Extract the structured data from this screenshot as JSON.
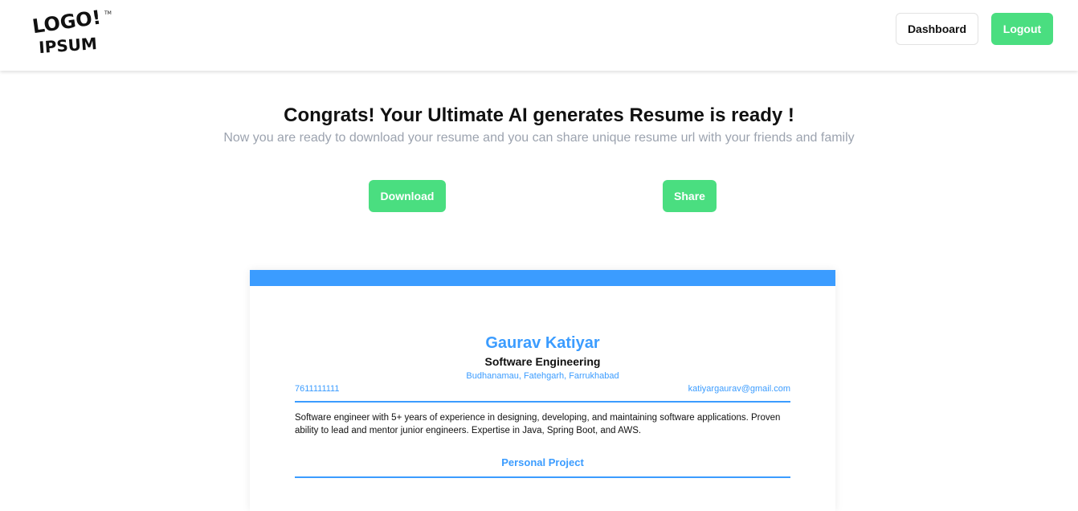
{
  "brand": {
    "logo_line1": "LOGO!",
    "logo_line2": "IPSUM",
    "logo_tm": "TM"
  },
  "header": {
    "dashboard_label": "Dashboard",
    "logout_label": "Logout"
  },
  "main": {
    "headline": "Congrats! Your Ultimate AI generates Resume is ready !",
    "subline": "Now you are ready to download your resume and you can share unique resume url with your friends and family",
    "download_label": "Download",
    "share_label": "Share"
  },
  "resume": {
    "name": "Gaurav Katiyar",
    "job_title": "Software Engineering",
    "address": "Budhanamau, Fatehgarh, Farrukhabad",
    "phone": "7611111111",
    "email": "katiyargaurav@gmail.com",
    "summary": "Software engineer with 5+ years of experience in designing, developing, and maintaining software applications. Proven ability to lead and mentor junior engineers. Expertise in Java, Spring Boot, and AWS.",
    "section_personal_project": "Personal Project"
  },
  "colors": {
    "accent_green": "#4ade80",
    "resume_blue": "#3b9cff",
    "muted_text": "#9ca3af"
  }
}
